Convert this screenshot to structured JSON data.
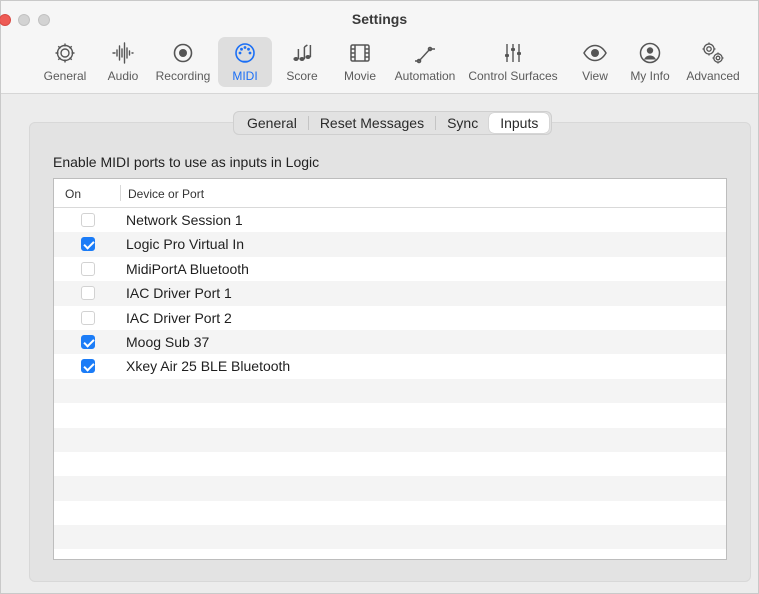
{
  "window": {
    "title": "Settings"
  },
  "toolbar": {
    "items": [
      {
        "label": "General",
        "icon": "gear-icon"
      },
      {
        "label": "Audio",
        "icon": "waveform-icon"
      },
      {
        "label": "Recording",
        "icon": "record-icon"
      },
      {
        "label": "MIDI",
        "icon": "midi-port-icon",
        "active": true
      },
      {
        "label": "Score",
        "icon": "music-notes-icon"
      },
      {
        "label": "Movie",
        "icon": "film-icon"
      },
      {
        "label": "Automation",
        "icon": "automation-curve-icon"
      },
      {
        "label": "Control Surfaces",
        "icon": "faders-icon"
      },
      {
        "label": "View",
        "icon": "eye-icon"
      },
      {
        "label": "My Info",
        "icon": "person-icon"
      },
      {
        "label": "Advanced",
        "icon": "gears-icon"
      }
    ]
  },
  "tabs": {
    "items": [
      "General",
      "Reset Messages",
      "Sync",
      "Inputs"
    ],
    "selected": "Inputs"
  },
  "inputs": {
    "instruction": "Enable MIDI ports to use as inputs in Logic",
    "columns": {
      "on": "On",
      "device": "Device or Port"
    },
    "rows": [
      {
        "name": "Network Session 1",
        "enabled": false
      },
      {
        "name": "Logic Pro Virtual In",
        "enabled": true
      },
      {
        "name": "MidiPortA Bluetooth",
        "enabled": false
      },
      {
        "name": "IAC Driver Port 1",
        "enabled": false
      },
      {
        "name": "IAC Driver Port 2",
        "enabled": false
      },
      {
        "name": "Moog Sub 37",
        "enabled": true
      },
      {
        "name": "Xkey Air 25 BLE Bluetooth",
        "enabled": true
      }
    ]
  },
  "colors": {
    "accent": "#1b7cf7",
    "close_button": "#ee5b55"
  }
}
